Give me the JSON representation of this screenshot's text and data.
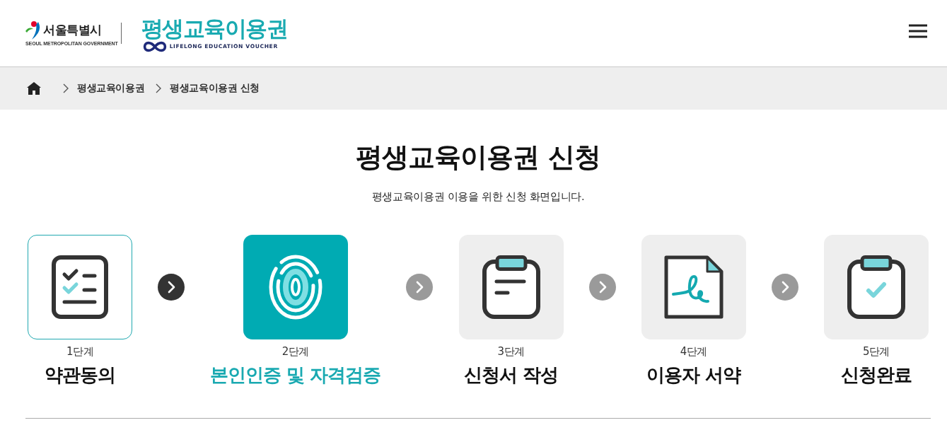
{
  "header": {
    "city_logo": {
      "name": "서울특별시",
      "subtitle": "SEOUL METROPOLITAN GOVERNMENT"
    },
    "service_logo": {
      "name": "평생교육이용권",
      "subtitle": "LIFELONG EDUCATION VOUCHER"
    }
  },
  "breadcrumb": [
    "평생교육이용권",
    "평생교육이용권 신청"
  ],
  "page": {
    "title": "평생교육이용권 신청",
    "subtitle": "평생교육이용권 이용을 위한 신청 화면입니다."
  },
  "steps": [
    {
      "kind": "checklist",
      "number": "1단계",
      "label": "약관동의",
      "completed": true,
      "selected": false
    },
    {
      "kind": "fingerprint",
      "number": "2단계",
      "label": "본인인증 및 자격검증",
      "completed": false,
      "selected": true
    },
    {
      "kind": "form",
      "number": "3단계",
      "label": "신청서 작성",
      "completed": false,
      "selected": false
    },
    {
      "kind": "signature",
      "number": "4단계",
      "label": "이용자 서약",
      "completed": false,
      "selected": false
    },
    {
      "kind": "done",
      "number": "5단계",
      "label": "신청완료",
      "completed": false,
      "selected": false
    }
  ]
}
